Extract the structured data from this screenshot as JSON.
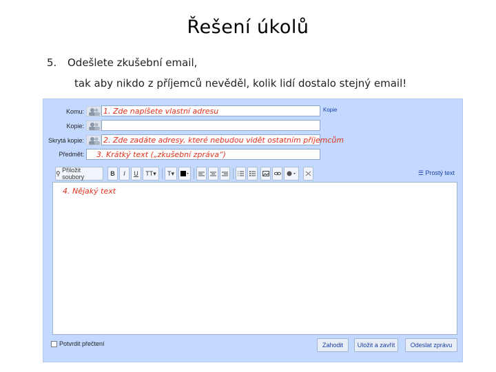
{
  "slide": {
    "title": "Řešení úkolů",
    "task_number": "5.",
    "task_line1": "Odešlete zkušební email,",
    "task_line2": "tak aby nikdo z příjemců nevěděl, kolik lidí dostalo stejný email!"
  },
  "compose": {
    "fields": {
      "to_label": "Komu:",
      "cc_label": "Kopie:",
      "bcc_label": "Skrytá kopie:",
      "subject_label": "Předmět:",
      "cc_link": "Kopie"
    },
    "annotations": {
      "to_note": "1. Zde napíšete vlastní adresu",
      "bcc_note": "2. Zde zadáte adresy, které nebudou vidět ostatním příjemcům",
      "subject_note": "3. Krátký text („zkušební zpráva“)",
      "body_note": "4. Nějaký text"
    },
    "toolbar": {
      "attach_label": "Přiložit soubory",
      "bold": "B",
      "italic": "I",
      "underline": "U",
      "font_size": "TT",
      "text_color": "T",
      "plain_text_label": "Prostý text",
      "icons": [
        "bold-icon",
        "italic-icon",
        "underline-icon",
        "font-size-icon",
        "text-color-icon",
        "highlight-color-icon",
        "align-left-icon",
        "align-center-icon",
        "align-right-icon",
        "numbered-list-icon",
        "bulleted-list-icon",
        "image-icon",
        "link-icon",
        "emoticon-icon",
        "remove-formatting-icon"
      ]
    },
    "footer": {
      "read_receipt_label": "Potvrdit přečtení",
      "discard_label": "Zahodit",
      "save_close_label": "Uložit a zavřít",
      "send_label": "Odeslat zprávu"
    },
    "colors": {
      "panel": "#c3d9ff",
      "annotation": "#e0311c",
      "link": "#1a3ea3"
    }
  }
}
